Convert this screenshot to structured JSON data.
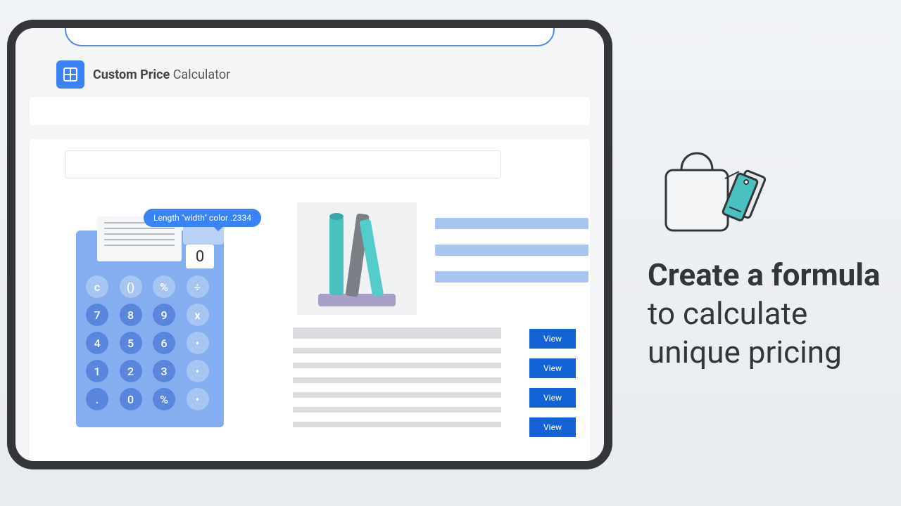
{
  "header": {
    "title_bold": "Custom Price",
    "title_rest": " Calculator"
  },
  "tooltip": "Length \"width\" color .2334",
  "calculator": {
    "display": "0",
    "row1": [
      "c",
      "()",
      "%",
      "÷"
    ],
    "row2": [
      "7",
      "8",
      "9",
      "x"
    ],
    "row3": [
      "4",
      "5",
      "6",
      "•"
    ],
    "row4": [
      "1",
      "2",
      "3",
      "•"
    ],
    "row5": [
      ".",
      "0",
      "%",
      "•"
    ]
  },
  "buttons": {
    "view": "View"
  },
  "promo": {
    "line1": "Create a formula",
    "line2": "to calculate",
    "line3": "unique pricing"
  }
}
